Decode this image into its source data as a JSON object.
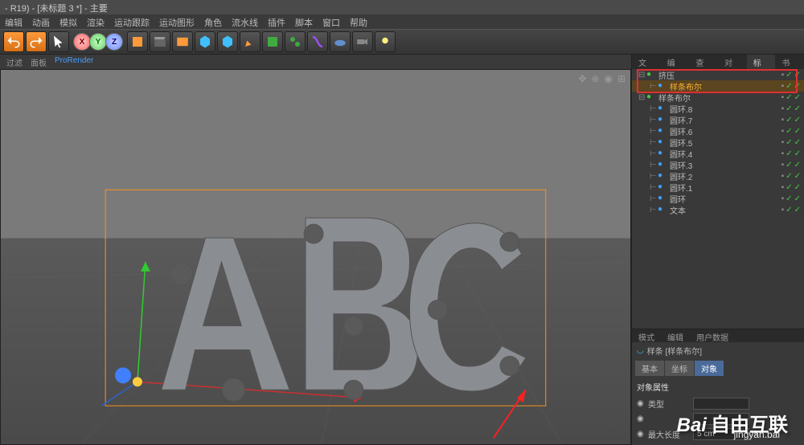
{
  "title": "- R19) - [未标题 3 *] - 主要",
  "menu": [
    "编辑",
    "动画",
    "模拟",
    "渲染",
    "运动跟踪",
    "运动图形",
    "角色",
    "流水线",
    "插件",
    "脚本",
    "窗口",
    "帮助"
  ],
  "viewport_tabs": [
    "过滤",
    "面板",
    "ProRender"
  ],
  "panel_tabs": [
    "文件",
    "编辑",
    "查看",
    "对象",
    "标签",
    "书签"
  ],
  "objects": [
    {
      "name": "挤压",
      "indent": 0,
      "expanded": true,
      "highlighted": true
    },
    {
      "name": "样条布尔",
      "indent": 1,
      "highlighted": true,
      "selected": true
    },
    {
      "name": "样条布尔",
      "indent": 0,
      "expanded": true
    },
    {
      "name": "圆环.8",
      "indent": 1
    },
    {
      "name": "圆环.7",
      "indent": 1
    },
    {
      "name": "圆环.6",
      "indent": 1
    },
    {
      "name": "圆环.5",
      "indent": 1
    },
    {
      "name": "圆环.4",
      "indent": 1
    },
    {
      "name": "圆环.3",
      "indent": 1
    },
    {
      "name": "圆环.2",
      "indent": 1
    },
    {
      "name": "圆环.1",
      "indent": 1
    },
    {
      "name": "圆环",
      "indent": 1
    },
    {
      "name": "文本",
      "indent": 1
    }
  ],
  "attr": {
    "tabs": [
      "模式",
      "编辑",
      "用户数据"
    ],
    "header": "样条 [样条布尔]",
    "subtabs": [
      "基本",
      "坐标",
      "对象"
    ],
    "section": "对象属性",
    "rows": [
      {
        "label": "类型",
        "value": ""
      },
      {
        "label": "",
        "value": ""
      },
      {
        "label": "最大长度",
        "value": "5 cm"
      }
    ]
  },
  "watermark": "自由互联",
  "watermark_brand": "Bai",
  "watermark_sub": "jingyan.bai"
}
